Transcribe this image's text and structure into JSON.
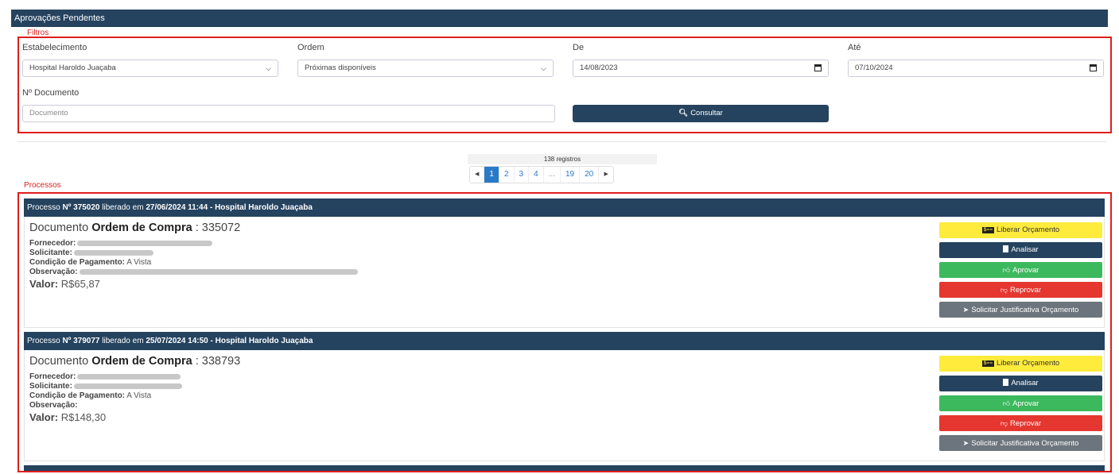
{
  "page_title": "Aprovações Pendentes",
  "filters": {
    "section_label": "Filtros",
    "estabelecimento_label": "Estabelecimento",
    "estabelecimento_value": "Hospital Haroldo Juaçaba",
    "ordem_label": "Ordem",
    "ordem_value": "Próximas disponíveis",
    "de_label": "De",
    "de_value": "14/08/2023",
    "ate_label": "Até",
    "ate_value": "07/10/2024",
    "documento_label": "Nº Documento",
    "documento_placeholder": "Documento",
    "consultar_label": "Consultar"
  },
  "pagination": {
    "records": "138 registros",
    "pages": [
      "1",
      "2",
      "3",
      "4",
      "...",
      "19",
      "20"
    ],
    "active_page": "1"
  },
  "processes_label": "Processos",
  "processes": [
    {
      "prefix": "Processo",
      "number": "Nº 375020",
      "released_text": "liberado em",
      "date": "27/06/2024 11:44",
      "hospital": "- Hospital Haroldo Juaçaba",
      "doc_prefix": "Documento",
      "doc_type": "Ordem de Compra",
      "doc_number": ": 335072",
      "fornecedor_label": "Fornecedor:",
      "solicitante_label": "Solicitante:",
      "condicao_label": "Condição de Pagamento:",
      "condicao_value": "A Vista",
      "observacao_label": "Observação:",
      "valor_label": "Valor:",
      "valor_value": "R$65,87"
    },
    {
      "prefix": "Processo",
      "number": "Nº 379077",
      "released_text": "liberado em",
      "date": "25/07/2024 14:50",
      "hospital": "- Hospital Haroldo Juaçaba",
      "doc_prefix": "Documento",
      "doc_type": "Ordem de Compra",
      "doc_number": ": 338793",
      "fornecedor_label": "Fornecedor:",
      "solicitante_label": "Solicitante:",
      "condicao_label": "Condição de Pagamento:",
      "condicao_value": "A Vista",
      "observacao_label": "Observação:",
      "valor_label": "Valor:",
      "valor_value": "R$148,30"
    }
  ],
  "actions": {
    "liberar": "Liberar Orçamento",
    "analisar": "Analisar",
    "aprovar": "Aprovar",
    "reprovar": "Reprovar",
    "solicitar": "Solicitar Justificativa Orçamento"
  },
  "icons": [
    "money-icon",
    "document-icon",
    "thumbs-up-icon",
    "thumbs-down-icon",
    "paper-plane-icon",
    "search-icon",
    "calendar-icon",
    "chevron-down-icon"
  ],
  "colors": {
    "navy": "#25435f",
    "highlight_red": "#e01e1e",
    "yellow": "#ffeb3b",
    "green": "#3cb95d",
    "red": "#e53630",
    "gray": "#6c757d",
    "link_blue": "#2a7ac8"
  }
}
